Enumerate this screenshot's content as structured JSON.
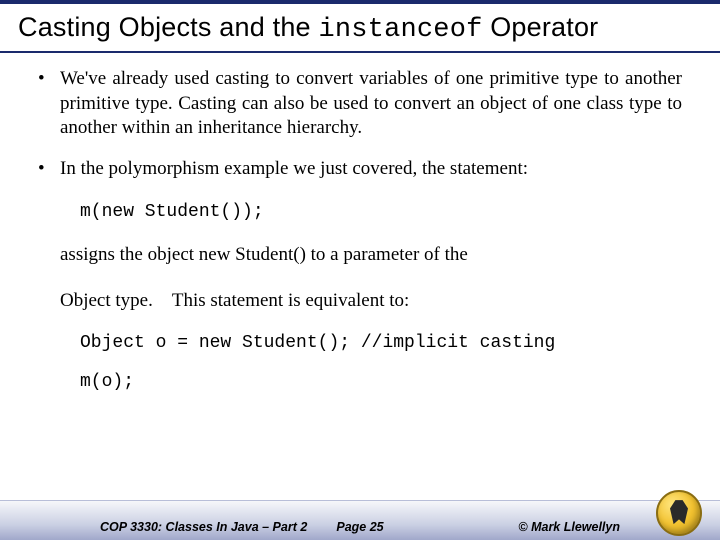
{
  "title": {
    "prefix": "Casting Objects and the ",
    "code": "instanceof",
    "suffix": " Operator"
  },
  "bullets": [
    "We've already used casting to convert variables of one primitive type to another primitive type.  Casting can also be used to convert an object of one class type to another within an inheritance hierarchy.",
    "In the polymorphism example we just covered, the statement:"
  ],
  "code1": "m(new Student());",
  "para1": "assigns the object new Student() to a parameter of the",
  "para2_a": "Object type.",
  "para2_b": "This statement is equivalent to:",
  "code2": "Object o = new Student();  //implicit casting",
  "code3": "m(o);",
  "footer": {
    "left": "COP 3330: Classes In Java – Part 2",
    "mid": "Page 25",
    "right": "© Mark Llewellyn"
  }
}
